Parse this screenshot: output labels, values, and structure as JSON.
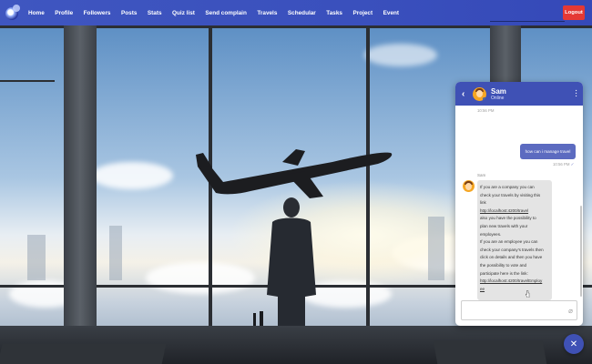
{
  "navbar": {
    "logo": "app-logo",
    "links": [
      "Home",
      "Profile",
      "Followers",
      "Posts",
      "Stats",
      "Quiz list",
      "Send complain",
      "Travels",
      "Schedular",
      "Tasks",
      "Project",
      "Event"
    ],
    "logout_label": "Logout",
    "color": "#3f51b5",
    "logout_color": "#e53935"
  },
  "chat": {
    "contact_name": "Sam",
    "contact_status": "Online",
    "icons": {
      "back": "chevron-left-icon",
      "menu": "more-vertical-icon",
      "attach": "paperclip-icon",
      "close": "close-icon"
    },
    "messages": [
      {
        "direction": "in-time-only",
        "time": "10:56 PM"
      },
      {
        "direction": "out",
        "text": "how can i manage travel",
        "time": "10:56 PM"
      },
      {
        "direction": "in",
        "sender": "Sam",
        "lines": [
          "If you are a company you can",
          "check your travels by visiting this",
          "link",
          "http://localhost:4200/travel",
          "also you have the possibility to",
          "plan new travels with your",
          "employees.",
          "If you are an employee you can",
          "check your company's travels then",
          "click on details and then you have",
          "the possibility to vote and",
          "participate here is the link:",
          "http://localhost:4200/travelEmploy",
          "ee"
        ],
        "time": "10:56 PM"
      }
    ],
    "input_placeholder": ""
  }
}
